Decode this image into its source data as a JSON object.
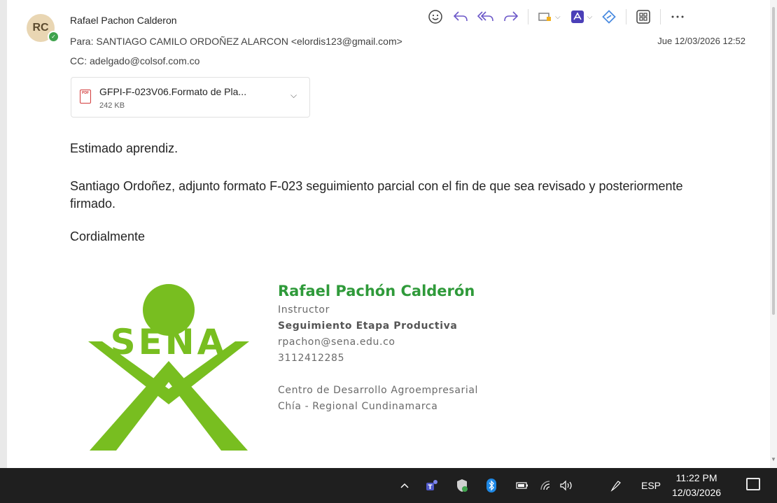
{
  "email": {
    "sender_initials": "RC",
    "sender_name": "Rafael Pachon Calderon",
    "to_label": "Para:",
    "to_value": "SANTIAGO CAMILO ORDOÑEZ ALARCON <elordis123@gmail.com>",
    "cc_label": "CC:",
    "cc_value": "adelgado@colsof.com.co",
    "date": "Jue 12/03/2026 12:52"
  },
  "attachment": {
    "file_name": "GFPI-F-023V06.Formato de Pla...",
    "file_size": "242 KB",
    "icon": "pdf-file-icon"
  },
  "body": {
    "greeting": "Estimado aprendiz.",
    "paragraph": "Santiago Ordoñez, adjunto formato F-023 seguimiento parcial con el fin de que sea revisado y posteriormente firmado.",
    "closing": "Cordialmente"
  },
  "signature": {
    "logo_text": "SENA",
    "name": "Rafael Pachón Calderón",
    "role": "Instructor",
    "area": "Seguimiento Etapa Productiva",
    "email": "rpachon@sena.edu.co",
    "phone": "3112412285",
    "center": "Centro de Desarrollo Agroempresarial",
    "location": "Chía - Regional Cundinamarca"
  },
  "toolbar": {
    "icons": [
      "emoji-icon",
      "reply-icon",
      "reply-all-icon",
      "forward-icon",
      "add-to-calendar-icon",
      "adobe-pdf-icon",
      "loop-icon",
      "apps-icon",
      "more-icon"
    ]
  },
  "taskbar": {
    "language": "ESP",
    "time": "11:22 PM",
    "date": "12/03/2026"
  },
  "colors": {
    "accent_purple": "#6b57c8",
    "sena_green": "#78be20",
    "signature_green": "#2f9a3a",
    "taskbar": "#1f1f1f"
  }
}
